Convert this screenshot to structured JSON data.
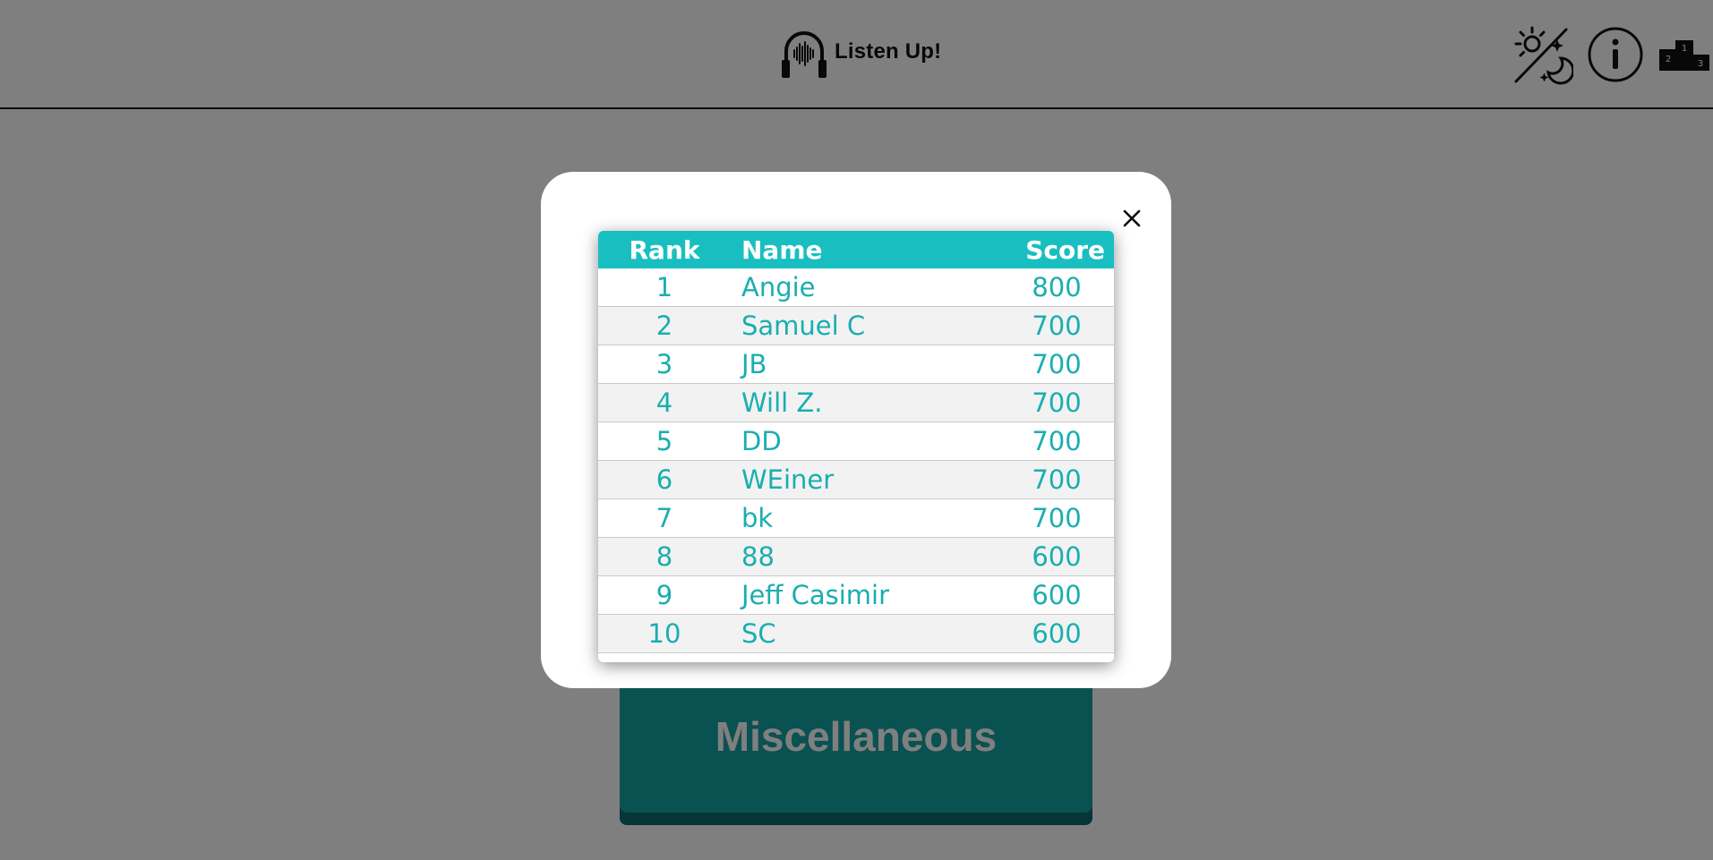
{
  "app": {
    "title": "Listen Up!"
  },
  "header": {
    "icons": [
      "headphones-soundwave-icon",
      "theme-toggle-icon",
      "info-icon",
      "leaderboard-podium-icon"
    ],
    "podium_labels": [
      "2",
      "1",
      "3"
    ]
  },
  "category": {
    "label": "Miscellaneous"
  },
  "modal": {
    "close_label": "×",
    "columns": {
      "rank": "Rank",
      "name": "Name",
      "score": "Score"
    },
    "rows": [
      {
        "rank": "1",
        "name": "Angie",
        "score": "800"
      },
      {
        "rank": "2",
        "name": "Samuel C",
        "score": "700"
      },
      {
        "rank": "3",
        "name": "JB",
        "score": "700"
      },
      {
        "rank": "4",
        "name": "Will Z.",
        "score": "700"
      },
      {
        "rank": "5",
        "name": "DD",
        "score": "700"
      },
      {
        "rank": "6",
        "name": "WEiner",
        "score": "700"
      },
      {
        "rank": "7",
        "name": "bk",
        "score": "700"
      },
      {
        "rank": "8",
        "name": "88",
        "score": "600"
      },
      {
        "rank": "9",
        "name": "Jeff Casimir",
        "score": "600"
      },
      {
        "rank": "10",
        "name": "SC",
        "score": "600"
      }
    ]
  },
  "colors": {
    "accent": "#19bfc0",
    "accent_text": "#1aaeb0",
    "button": "#15a3a3",
    "button_shadow": "#0d6b6b",
    "overlay": "rgba(0,0,0,0.5)"
  }
}
